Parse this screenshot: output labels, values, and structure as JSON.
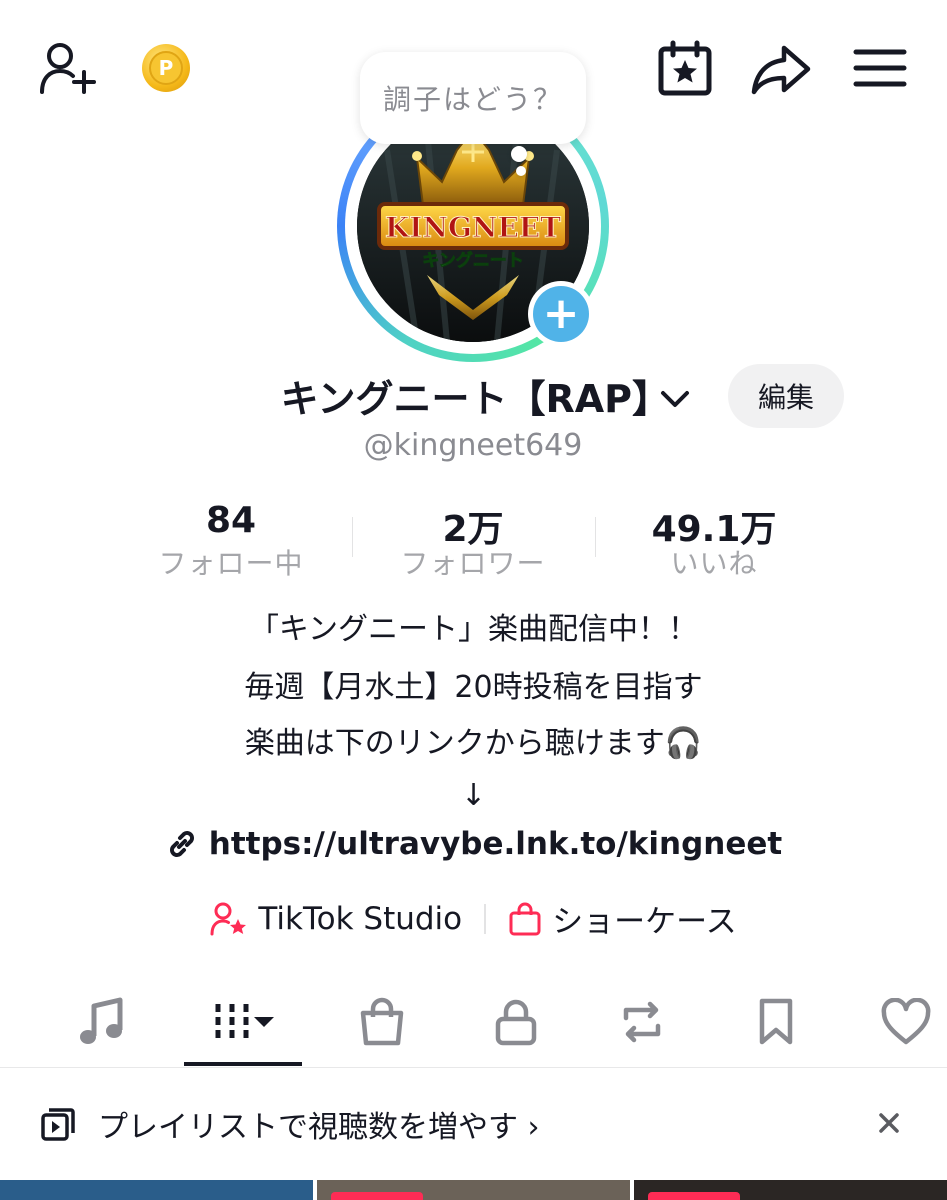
{
  "status_bubble": {
    "text": "調子はどう？"
  },
  "profile": {
    "name": "キングニート【RAP】",
    "handle": "@kingneet649",
    "edit_label": "編集",
    "avatar_logo_text": "KINGNEET",
    "avatar_logo_subtext": "キングニート"
  },
  "stats": [
    {
      "value": "84",
      "label": "フォロー中"
    },
    {
      "value": "2万",
      "label": "フォロワー"
    },
    {
      "value": "49.1万",
      "label": "いいね"
    }
  ],
  "bio": {
    "line1": "「キングニート」楽曲配信中！！",
    "line2": "毎週【月水土】20時投稿を目指す",
    "line3": "楽曲は下のリンクから聴けます🎧",
    "line4": "↓",
    "link": "https://ultravybe.lnk.to/kingneet"
  },
  "shortcuts": {
    "studio": "TikTok Studio",
    "showcase": "ショーケース"
  },
  "tabs": [
    {
      "icon": "music-note-icon"
    },
    {
      "icon": "videos-grid-icon",
      "active": true
    },
    {
      "icon": "shopping-bag-icon"
    },
    {
      "icon": "lock-icon"
    },
    {
      "icon": "repost-icon"
    },
    {
      "icon": "bookmark-icon"
    },
    {
      "icon": "heart-icon"
    }
  ],
  "playlist_banner": {
    "text": "プレイリストで視聴数を増やす ›"
  },
  "colors": {
    "accent_red": "#fe2c55",
    "avatar_plus": "#50b3e8",
    "secondary_text": "#8a8b91"
  }
}
